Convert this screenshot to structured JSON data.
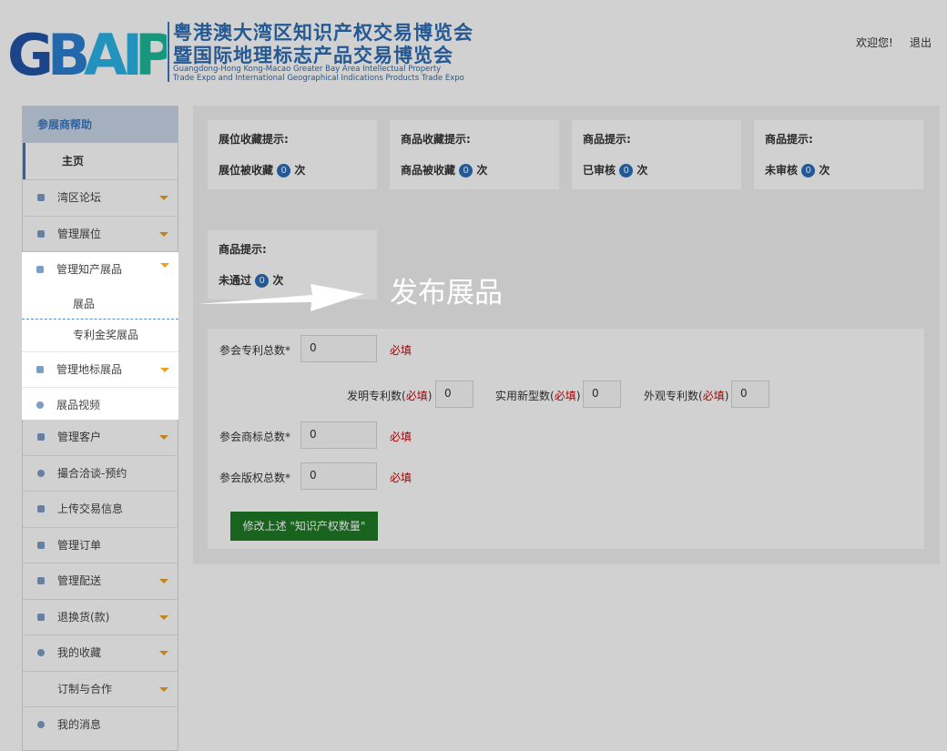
{
  "header": {
    "logo_mark": "GBAIP",
    "logo_title_1": "粤港澳大湾区知识产权交易博览会",
    "logo_title_2": "暨国际地理标志产品交易博览会",
    "logo_en_1": "Guangdong-Hong Kong-Macao Greater Bay Area Intellectual Property",
    "logo_en_2": "Trade Expo and International Geographical Indications Products Trade Expo",
    "welcome": "欢迎您!",
    "logout": "退出",
    "logo_colors": {
      "dark_blue": "#2354a6",
      "light_blue": "#2bb2e6",
      "green": "#1fb89a"
    }
  },
  "sidebar": {
    "header": "参展商帮助",
    "home": "主页",
    "items_top": [
      {
        "label": "湾区论坛",
        "icon": "forum-icon",
        "expandable": true
      },
      {
        "label": "管理展位",
        "icon": "booth-icon",
        "expandable": true
      }
    ],
    "highlight": {
      "ip_exhibits": {
        "label": "管理知产展品",
        "icon": "grid-icon",
        "expandable": true
      },
      "sub_items": [
        "展品",
        "专利金奖展品"
      ],
      "gi_exhibits": {
        "label": "管理地标展品",
        "icon": "grid-icon",
        "expandable": true
      },
      "video": {
        "label": "展品视频",
        "icon": "video-icon",
        "expandable": false
      }
    },
    "items_bottom": [
      {
        "label": "管理客户",
        "icon": "user-icon",
        "expandable": true
      },
      {
        "label": "撮合洽谈-预约",
        "icon": "handshake-icon",
        "expandable": false
      },
      {
        "label": "上传交易信息",
        "icon": "document-icon",
        "expandable": false
      },
      {
        "label": "管理订单",
        "icon": "order-icon",
        "expandable": false
      },
      {
        "label": "管理配送",
        "icon": "delivery-icon",
        "expandable": true
      },
      {
        "label": "退换货(款)",
        "icon": "return-icon",
        "expandable": true
      },
      {
        "label": "我的收藏",
        "icon": "star-icon",
        "expandable": true
      },
      {
        "label": "订制与合作",
        "icon": "",
        "expandable": true
      },
      {
        "label": "我的消息",
        "icon": "message-icon",
        "expandable": false
      }
    ]
  },
  "stats": [
    {
      "title": "展位收藏提示:",
      "prefix": "展位被收藏",
      "count": "0",
      "suffix": "次"
    },
    {
      "title": "商品收藏提示:",
      "prefix": "商品被收藏",
      "count": "0",
      "suffix": "次"
    },
    {
      "title": "商品提示:",
      "prefix": "已审核",
      "count": "0",
      "suffix": "次"
    },
    {
      "title": "商品提示:",
      "prefix": "未审核",
      "count": "0",
      "suffix": "次"
    },
    {
      "title": "商品提示:",
      "prefix": "未通过",
      "count": "0",
      "suffix": "次"
    }
  ],
  "form": {
    "patent_total_label": "参会专利总数*",
    "patent_total_value": "0",
    "required": "必填",
    "invention_label": "发明专利数(",
    "invention_required": "必填",
    "invention_close": ")",
    "invention_value": "0",
    "utility_label": "实用新型数(",
    "utility_required": "必填",
    "utility_close": ")",
    "utility_value": "0",
    "design_label": "外观专利数(",
    "design_required": "必填",
    "design_close": ")",
    "design_value": "0",
    "trademark_total_label": "参会商标总数*",
    "trademark_total_value": "0",
    "copyright_total_label": "参会版权总数*",
    "copyright_total_value": "0",
    "submit_label": "修改上述 \"知识产权数量\""
  },
  "annotation": {
    "label": "发布展品"
  },
  "colors": {
    "primary": "#2d6db5",
    "accent_caret": "#f0a020",
    "submit": "#1e7a25",
    "required": "#cc0000"
  }
}
